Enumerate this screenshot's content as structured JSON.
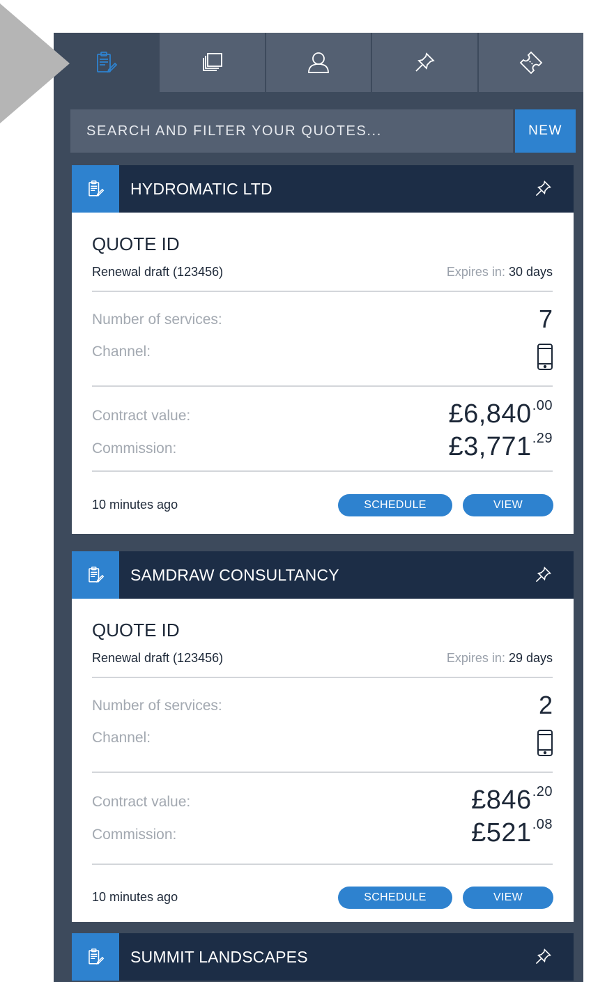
{
  "tabs": [
    {
      "name": "quotes",
      "icon": "clipboard-icon",
      "active": true
    },
    {
      "name": "documents",
      "icon": "stacked-pages-icon",
      "active": false
    },
    {
      "name": "customers",
      "icon": "user-icon",
      "active": false
    },
    {
      "name": "pinned",
      "icon": "pin-icon",
      "active": false
    },
    {
      "name": "tickets",
      "icon": "ticket-icon",
      "active": false
    }
  ],
  "search": {
    "placeholder": "SEARCH AND FILTER YOUR QUOTES..."
  },
  "new_button": {
    "label": "NEW"
  },
  "quotes": [
    {
      "company": "HYDROMATIC LTD",
      "quote_id_label": "QUOTE ID",
      "draft": "Renewal draft (123456)",
      "expires_label": "Expires in: ",
      "expires_value": "30 days",
      "services_label": "Number of services:",
      "services_value": "7",
      "channel_label": "Channel:",
      "channel_icon": "mobile-phone-icon",
      "contract_label": "Contract value:",
      "contract_main": "£6,840",
      "contract_decimal": ".00",
      "commission_label": "Commission:",
      "commission_main": "£3,771",
      "commission_decimal": ".29",
      "updated": "10 minutes ago",
      "schedule_label": "SCHEDULE",
      "view_label": "VIEW"
    },
    {
      "company": "SAMDRAW CONSULTANCY",
      "quote_id_label": "QUOTE ID",
      "draft": "Renewal draft (123456)",
      "expires_label": "Expires in: ",
      "expires_value": "29 days",
      "services_label": "Number of services:",
      "services_value": "2",
      "channel_label": "Channel:",
      "channel_icon": "mobile-phone-icon",
      "contract_label": "Contract value:",
      "contract_main": "£846",
      "contract_decimal": ".20",
      "commission_label": "Commission:",
      "commission_main": "£521",
      "commission_decimal": ".08",
      "updated": "10 minutes ago",
      "schedule_label": "SCHEDULE",
      "view_label": "VIEW"
    },
    {
      "company": "SUMMIT LANDSCAPES"
    }
  ],
  "colors": {
    "panel": "#3d4a5c",
    "tab": "#546072",
    "header": "#1c2d46",
    "accent": "#2e82cf"
  }
}
